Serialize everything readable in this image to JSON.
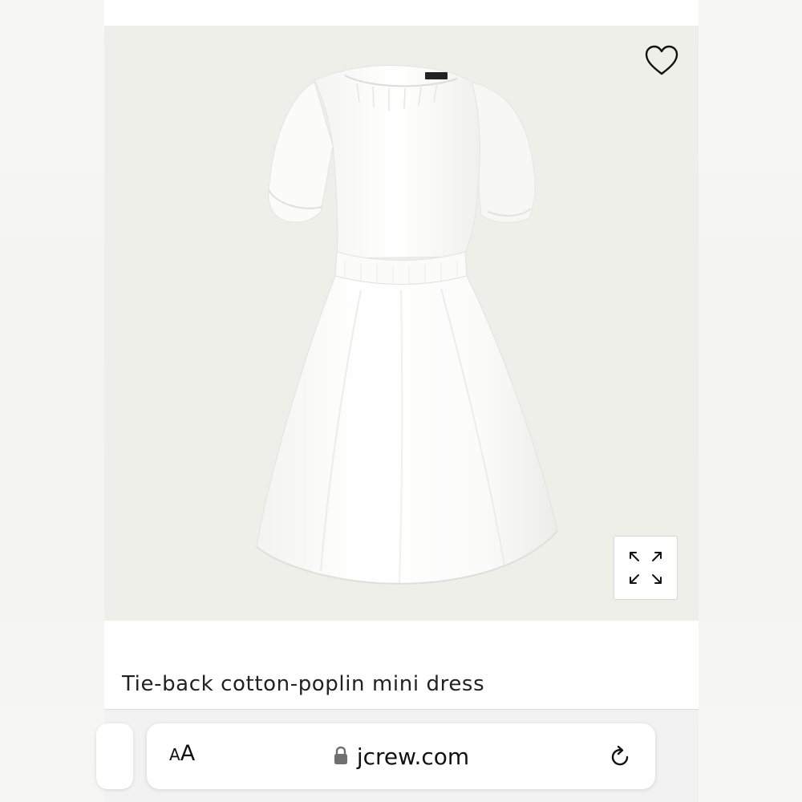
{
  "product": {
    "title": "Tie-back cotton-poplin mini dress",
    "image_alt": "White tie-back cotton-poplin mini dress",
    "image_background": "#efefea"
  },
  "image_controls": {
    "wishlist_icon": "heart-outline-icon",
    "expand_icon": "expand-arrows-icon"
  },
  "browser": {
    "text_size_label_small": "A",
    "text_size_label_large": "A",
    "lock_icon": "lock-icon",
    "url": "jcrew.com",
    "reload_icon": "reload-icon"
  }
}
